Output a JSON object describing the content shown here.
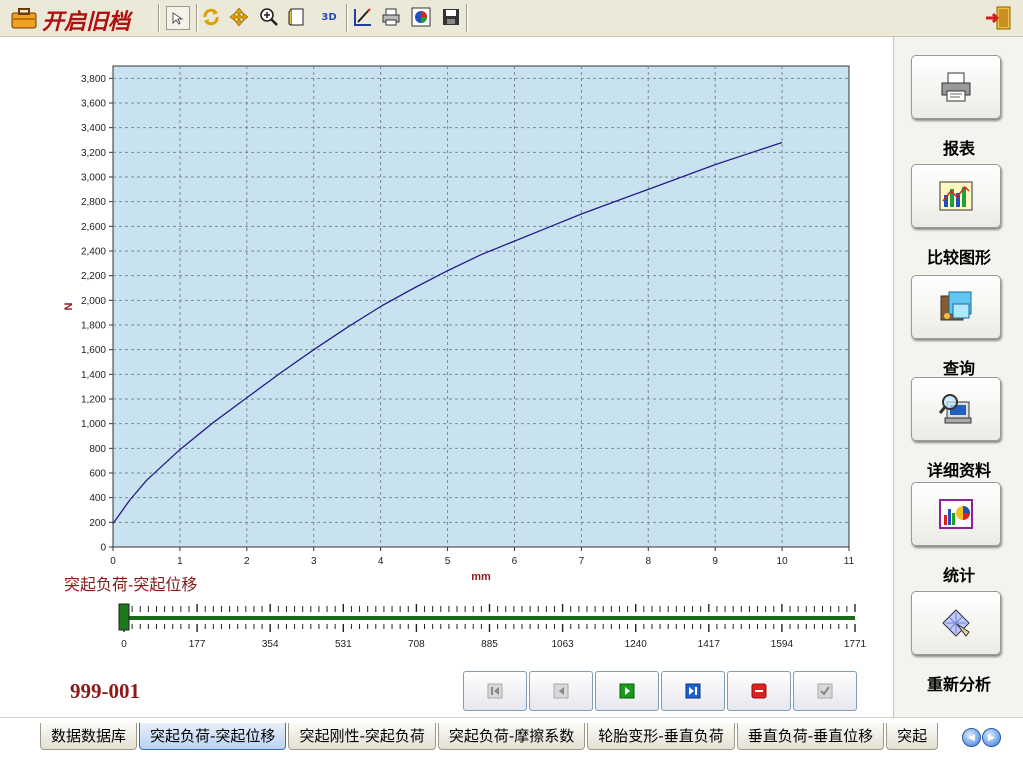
{
  "toolbar": {
    "title": "开启旧档",
    "btn_3d_label": "3D"
  },
  "chart_data": {
    "type": "line",
    "xlabel": "mm",
    "ylabel": "N",
    "xlim": [
      0,
      11
    ],
    "ylim": [
      0,
      3900
    ],
    "x_ticks": [
      0,
      1,
      2,
      3,
      4,
      5,
      6,
      7,
      8,
      9,
      10,
      11
    ],
    "y_ticks": [
      "0",
      "200",
      "400",
      "600",
      "800",
      "1,000",
      "1,200",
      "1,400",
      "1,600",
      "1,800",
      "2,000",
      "2,200",
      "2,400",
      "2,600",
      "2,800",
      "3,000",
      "3,200",
      "3,400",
      "3,600",
      "3,800"
    ],
    "y_tick_values": [
      0,
      200,
      400,
      600,
      800,
      1000,
      1200,
      1400,
      1600,
      1800,
      2000,
      2200,
      2400,
      2600,
      2800,
      3000,
      3200,
      3400,
      3600,
      3800
    ],
    "grid": true,
    "series": [
      {
        "color": "#2a1a8a",
        "x": [
          0,
          0.25,
          0.5,
          1,
          1.5,
          2,
          2.5,
          3,
          3.5,
          4,
          4.5,
          5,
          5.5,
          6,
          6.5,
          7,
          7.5,
          8,
          8.5,
          9,
          9.5,
          10
        ],
        "y": [
          190,
          380,
          540,
          790,
          1010,
          1210,
          1410,
          1600,
          1780,
          1950,
          2100,
          2240,
          2370,
          2480,
          2590,
          2700,
          2800,
          2900,
          3000,
          3100,
          3190,
          3280
        ]
      }
    ],
    "caption": "突起负荷-突起位移"
  },
  "slider": {
    "labels": [
      "0",
      "177",
      "354",
      "531",
      "708",
      "885",
      "1063",
      "1240",
      "1417",
      "1594",
      "1771"
    ],
    "position": 0
  },
  "record_id": "999-001",
  "side_panel": [
    {
      "label": "报表",
      "icon": "printer-icon"
    },
    {
      "label": "比较图形",
      "icon": "compare-chart-icon"
    },
    {
      "label": "查询",
      "icon": "query-icon"
    },
    {
      "label": "详细资料",
      "icon": "details-icon"
    },
    {
      "label": "统计",
      "icon": "statistics-icon"
    },
    {
      "label": "重新分析",
      "icon": "reanalyze-icon"
    }
  ],
  "tabs": [
    {
      "label": "数据数据库",
      "active": false
    },
    {
      "label": "突起负荷-突起位移",
      "active": true
    },
    {
      "label": "突起刚性-突起负荷",
      "active": false
    },
    {
      "label": "突起负荷-摩擦系数",
      "active": false
    },
    {
      "label": "轮胎变形-垂直负荷",
      "active": false
    },
    {
      "label": "垂直负荷-垂直位移",
      "active": false
    },
    {
      "label": "突起",
      "active": false
    }
  ],
  "colors": {
    "plot_bg": "#c8e2f0",
    "curve": "#2a1a8a",
    "caption": "#8b1a1a",
    "slider_track": "#1a6a1a"
  }
}
